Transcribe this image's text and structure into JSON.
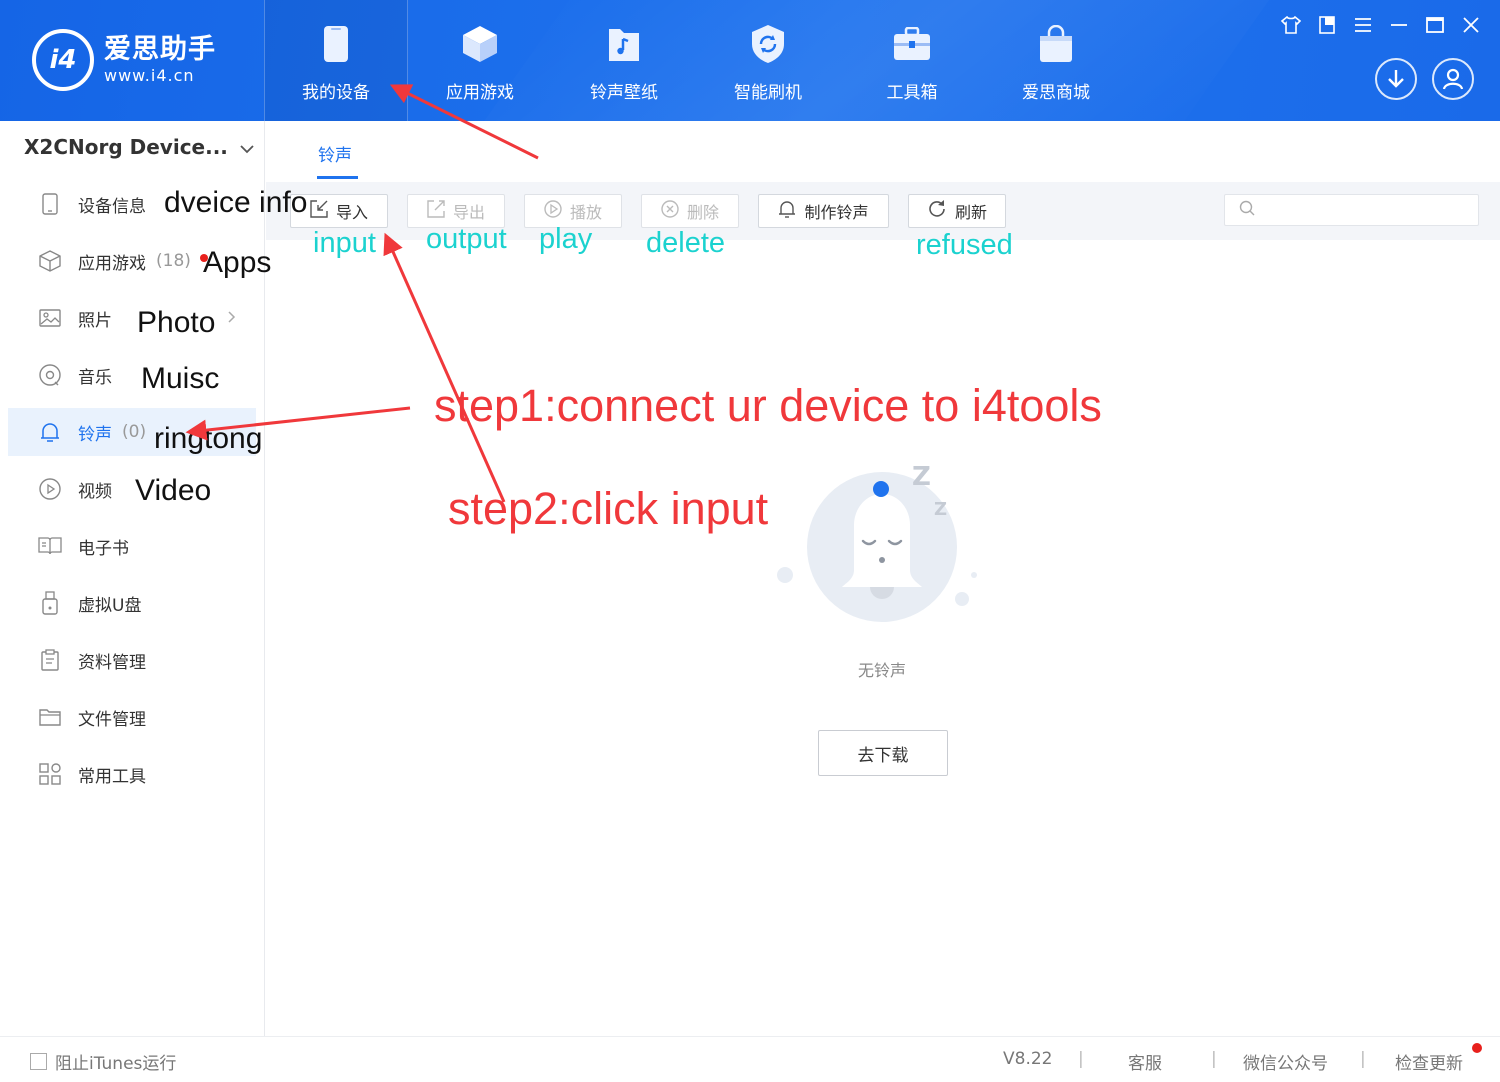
{
  "app": {
    "title": "爱思助手",
    "url": "www.i4.cn",
    "logo_mark": "i4"
  },
  "nav": [
    {
      "label": "我的设备",
      "icon": "phone-icon"
    },
    {
      "label": "应用游戏",
      "icon": "cube-icon"
    },
    {
      "label": "铃声壁纸",
      "icon": "music-folder-icon"
    },
    {
      "label": "智能刷机",
      "icon": "refresh-shield-icon"
    },
    {
      "label": "工具箱",
      "icon": "toolbox-icon"
    },
    {
      "label": "爱思商城",
      "icon": "shopping-bag-icon"
    }
  ],
  "device": {
    "name": "X2CNorg Device..."
  },
  "sidebar": {
    "items": [
      {
        "label": "设备信息",
        "count": "",
        "icon": "device-icon"
      },
      {
        "label": "应用游戏",
        "count": "(18)",
        "icon": "cube-outline-icon"
      },
      {
        "label": "照片",
        "count": "",
        "icon": "photo-icon"
      },
      {
        "label": "音乐",
        "count": "",
        "icon": "music-disc-icon"
      },
      {
        "label": "铃声",
        "count": "(0)",
        "icon": "bell-icon"
      },
      {
        "label": "视频",
        "count": "",
        "icon": "play-circle-icon"
      },
      {
        "label": "电子书",
        "count": "",
        "icon": "book-icon"
      },
      {
        "label": "虚拟U盘",
        "count": "",
        "icon": "usb-drive-icon"
      },
      {
        "label": "资料管理",
        "count": "",
        "icon": "document-icon"
      },
      {
        "label": "文件管理",
        "count": "",
        "icon": "folder-icon"
      },
      {
        "label": "常用工具",
        "count": "",
        "icon": "grid-tools-icon"
      }
    ]
  },
  "main": {
    "tab": "铃声",
    "toolbar": {
      "import": "导入",
      "export": "导出",
      "play": "播放",
      "delete": "删除",
      "make": "制作铃声",
      "refresh": "刷新",
      "search_placeholder": ""
    },
    "empty_text": "无铃声",
    "download_button": "去下载"
  },
  "statusbar": {
    "stop_itunes": "阻止iTunes运行",
    "version": "V8.22",
    "support": "客服",
    "wechat": "微信公众号",
    "update": "检查更新",
    "separator": "|"
  },
  "annotations": {
    "device_info": "dveice info",
    "apps": "Apps",
    "photo": "Photo",
    "music": "Muisc",
    "ringtone": "ringtong",
    "video": "Video",
    "input": "input",
    "output": "output",
    "play": "play",
    "delete": "delete",
    "refused": "refused",
    "step1": "step1:connect ur device to i4tools",
    "step2": "step2:click input"
  },
  "colors": {
    "brand_blue": "#1f73ee",
    "annotation_red": "#f0383b",
    "annotation_cyan": "#1bd2cf"
  }
}
